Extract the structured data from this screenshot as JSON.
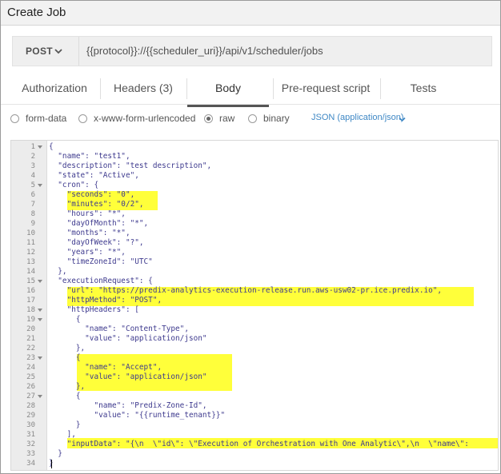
{
  "window": {
    "title": "Create Job"
  },
  "request": {
    "method": "POST",
    "url": "{{protocol}}://{{scheduler_uri}}/api/v1/scheduler/jobs"
  },
  "tabs": [
    {
      "label": "Authorization",
      "active": false
    },
    {
      "label": "Headers (3)",
      "active": false
    },
    {
      "label": "Body",
      "active": true
    },
    {
      "label": "Pre-request script",
      "active": false
    },
    {
      "label": "Tests",
      "active": false
    }
  ],
  "body_options": {
    "modes": [
      {
        "label": "form-data",
        "selected": false
      },
      {
        "label": "x-www-form-urlencoded",
        "selected": false
      },
      {
        "label": "raw",
        "selected": true
      },
      {
        "label": "binary",
        "selected": false
      }
    ],
    "content_type": "JSON (application/json)"
  },
  "editor": {
    "highlight_color": "#ffff3a",
    "lines": [
      {
        "n": "1",
        "text": "{"
      },
      {
        "n": "2",
        "text": "  \"name\": \"test1\","
      },
      {
        "n": "3",
        "text": "  \"description\": \"test description\","
      },
      {
        "n": "4",
        "text": "  \"state\": \"Active\","
      },
      {
        "n": "5",
        "text": "  \"cron\": {"
      },
      {
        "n": "6",
        "text": "    \"seconds\": \"0\","
      },
      {
        "n": "7",
        "text": "    \"minutes\": \"0/2\","
      },
      {
        "n": "8",
        "text": "    \"hours\": \"*\","
      },
      {
        "n": "9",
        "text": "    \"dayOfMonth\": \"*\","
      },
      {
        "n": "10",
        "text": "    \"months\": \"*\","
      },
      {
        "n": "11",
        "text": "    \"dayOfWeek\": \"?\","
      },
      {
        "n": "12",
        "text": "    \"years\": \"*\","
      },
      {
        "n": "13",
        "text": "    \"timeZoneId\": \"UTC\""
      },
      {
        "n": "14",
        "text": "  },"
      },
      {
        "n": "15",
        "text": "  \"executionRequest\": {"
      },
      {
        "n": "16",
        "text": "    \"url\": \"https://predix-analytics-execution-release.run.aws-usw02-pr.ice.predix.io\","
      },
      {
        "n": "17",
        "text": "    \"httpMethod\": \"POST\","
      },
      {
        "n": "18",
        "text": "    \"httpHeaders\": ["
      },
      {
        "n": "19",
        "text": "      {"
      },
      {
        "n": "20",
        "text": "        \"name\": \"Content-Type\","
      },
      {
        "n": "21",
        "text": "        \"value\": \"application/json\""
      },
      {
        "n": "22",
        "text": "      },"
      },
      {
        "n": "23",
        "text": "      {"
      },
      {
        "n": "24",
        "text": "        \"name\": \"Accept\","
      },
      {
        "n": "25",
        "text": "        \"value\": \"application/json\""
      },
      {
        "n": "26",
        "text": "      },"
      },
      {
        "n": "27",
        "text": "      {"
      },
      {
        "n": "28",
        "text": "          \"name\": \"Predix-Zone-Id\","
      },
      {
        "n": "29",
        "text": "          \"value\": \"{{runtime_tenant}}\""
      },
      {
        "n": "30",
        "text": "      }"
      },
      {
        "n": "31",
        "text": "    ],"
      },
      {
        "n": "32",
        "text": "    \"inputData\": \"{\\n  \\\"id\\\": \\\"Execution of Orchestration with One Analytic\\\",\\n  \\\"name\\\":"
      },
      {
        "n": "33",
        "text": "  }"
      },
      {
        "n": "34",
        "text": "}"
      }
    ]
  }
}
